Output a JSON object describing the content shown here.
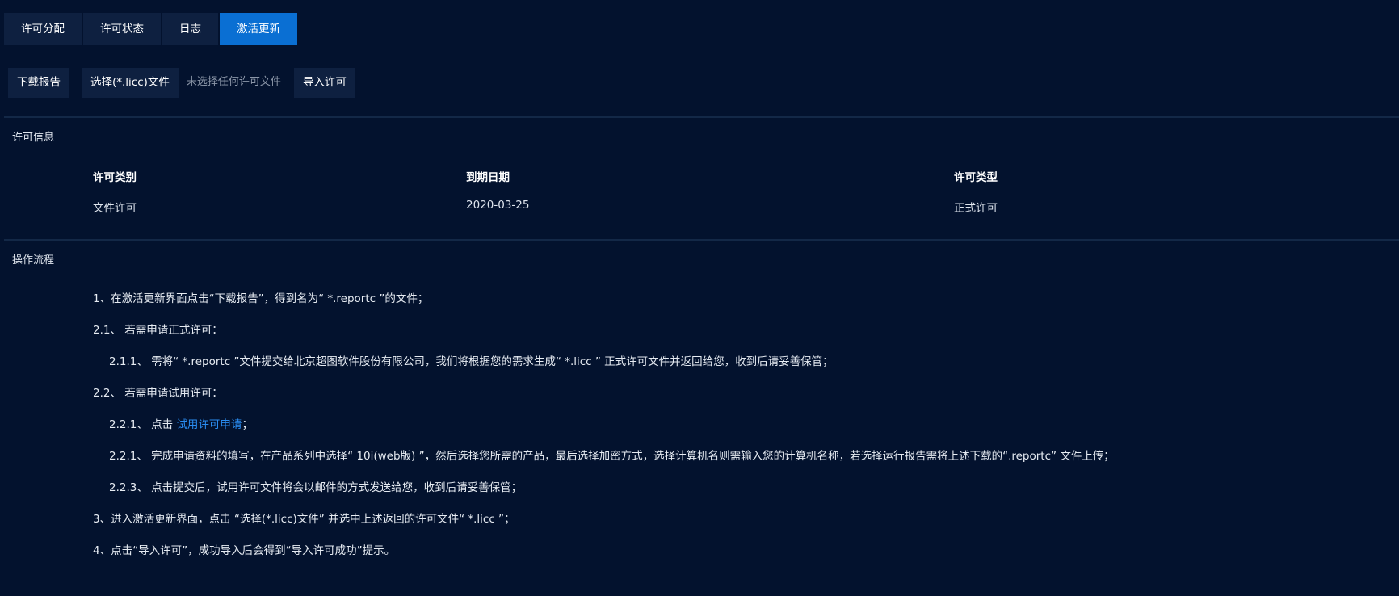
{
  "tabs": [
    {
      "label": "许可分配",
      "active": false
    },
    {
      "label": "许可状态",
      "active": false
    },
    {
      "label": "日志",
      "active": false
    },
    {
      "label": "激活更新",
      "active": true
    }
  ],
  "toolbar": {
    "download_report": "下载报告",
    "choose_file": "选择(*.licc)文件",
    "file_status": "未选择任何许可文件",
    "import_license": "导入许可"
  },
  "license_info": {
    "title": "许可信息",
    "headers": [
      "许可类别",
      "到期日期",
      "许可类型"
    ],
    "row": [
      "文件许可",
      "2020-03-25",
      "正式许可"
    ]
  },
  "procedure": {
    "title": "操作流程",
    "step1": "1、在激活更新界面点击“下载报告”，得到名为“ *.reportc ”的文件；",
    "step2_1": "2.1、 若需申请正式许可：",
    "step2_1_1": "2.1.1、 需将“ *.reportc ”文件提交给北京超图软件股份有限公司，我们将根据您的需求生成“ *.licc ” 正式许可文件并返回给您，收到后请妥善保管；",
    "step2_2": "2.2、 若需申请试用许可：",
    "step2_2_1_prefix": "2.2.1、 点击 ",
    "step2_2_1_link": "试用许可申请",
    "step2_2_1_suffix": "；",
    "step2_2_1b": "2.2.1、 完成申请资料的填写，在产品系列中选择“ 10i(web版) ”，然后选择您所需的产品，最后选择加密方式，选择计算机名则需输入您的计算机名称，若选择运行报告需将上述下载的“.reportc” 文件上传；",
    "step2_2_3": "2.2.3、 点击提交后，试用许可文件将会以邮件的方式发送给您，收到后请妥善保管；",
    "step3": "3、进入激活更新界面，点击 “选择(*.licc)文件” 并选中上述返回的许可文件“ *.licc ”；",
    "step4": "4、点击“导入许可”，成功导入后会得到“导入许可成功”提示。"
  },
  "colors": {
    "background": "#03122e",
    "tab_active": "#0a6fd3",
    "tab_inactive": "#0e2040",
    "link": "#2a8cf0"
  }
}
